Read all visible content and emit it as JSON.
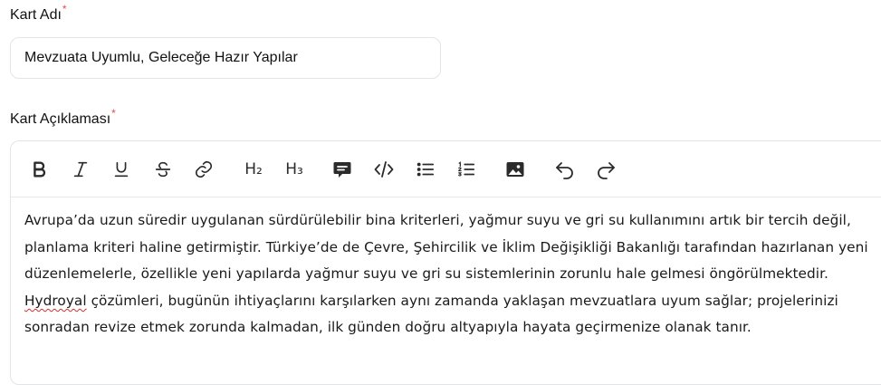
{
  "form": {
    "card_name": {
      "label": "Kart Adı",
      "required_mark": "*",
      "value": "Mevzuata Uyumlu, Geleceğe Hazır Yapılar"
    },
    "card_description": {
      "label": "Kart Açıklaması",
      "required_mark": "*",
      "toolbar": {
        "heading2_label": "H₂",
        "heading3_label": "H₃"
      },
      "text_before": "Avrupa’da uzun süredir uygulanan sürdürülebilir bina kriterleri, yağmur suyu ve gri su kullanımını artık bir tercih değil, planlama kriteri haline getirmiştir. Türkiye’de de Çevre, Şehircilik ve İklim Değişikliği Bakanlığı tarafından hazırlanan yeni düzenlemelerle, özellikle yeni yapılarda yağmur suyu ve gri su sistemlerinin zorunlu hale gelmesi öngörülmektedir. ",
      "misspelled_word": "Hydroyal",
      "text_after": " çözümleri, bugünün ihtiyaçlarını karşılarken aynı zamanda yaklaşan mevzuatlara uyum sağlar; projelerinizi sonradan revize etmek zorunda kalmadan, ilk günden doğru altyapıyla hayata geçirmenize olanak tanır."
    }
  },
  "colors": {
    "required_mark": "#e5484d",
    "border": "#e2e4e8",
    "spellcheck_underline": "#d0312d"
  },
  "icons": [
    "bold-icon",
    "italic-icon",
    "underline-icon",
    "strikethrough-icon",
    "link-icon",
    "comment-icon",
    "code-icon",
    "bullet-list-icon",
    "ordered-list-icon",
    "image-icon",
    "undo-icon",
    "redo-icon"
  ]
}
